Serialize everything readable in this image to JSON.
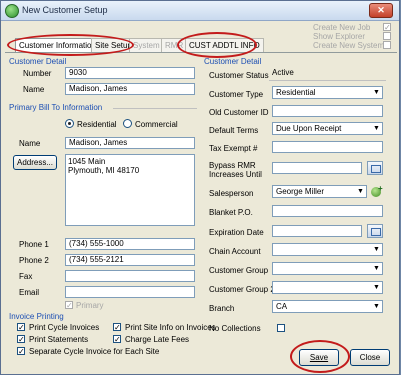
{
  "window": {
    "title": "New Customer Setup",
    "close": "✕"
  },
  "top_links": [
    {
      "label": "Create New Job",
      "checked": true
    },
    {
      "label": "Show Explorer",
      "checked": false
    },
    {
      "label": "Create New System",
      "checked": false
    }
  ],
  "tabs": [
    "Customer Information",
    "Site Setup",
    "System",
    "RMR",
    "CUST ADDTL INFO"
  ],
  "customer_detail": {
    "header": "Customer Detail",
    "number_label": "Number",
    "number": "9030",
    "name_label": "Name",
    "name": "Madison, James"
  },
  "bill_to": {
    "header": "Primary Bill To Information",
    "residential_label": "Residential",
    "commercial_label": "Commercial",
    "name_label": "Name",
    "name": "Madison, James",
    "address_button": "Address...",
    "address_line1": "1045 Main",
    "address_line2": "Plymouth, MI  48170",
    "phone1_label": "Phone 1",
    "phone1": "(734) 555-1000",
    "phone2_label": "Phone 2",
    "phone2": "(734) 555-2121",
    "fax_label": "Fax",
    "email_label": "Email",
    "primary_label": "Primary"
  },
  "invoice_printing": {
    "header": "Invoice Printing",
    "print_cycle": "Print Cycle Invoices",
    "print_site_info": "Print Site Info on Invoices",
    "print_statements": "Print Statements",
    "charge_late_fees": "Charge Late Fees",
    "separate_cycle": "Separate Cycle Invoice for Each Site"
  },
  "right_detail": {
    "header": "Customer Detail",
    "status_label": "Customer Status",
    "status": "Active",
    "type_label": "Customer Type",
    "type": "Residential",
    "old_id_label": "Old Customer ID",
    "terms_label": "Default Terms",
    "terms": "Due Upon Receipt",
    "tax_label": "Tax Exempt #",
    "bypass_label_1": "Bypass RMR",
    "bypass_label_2": "Increases Until",
    "salesperson_label": "Salesperson",
    "salesperson": "George Miller",
    "blanket_label": "Blanket P.O.",
    "expiration_label": "Expiration Date",
    "chain_label": "Chain Account",
    "group_label": "Customer Group",
    "group2_label": "Customer Group 2",
    "branch_label": "Branch",
    "branch": "CA",
    "no_collections_label": "No Collections"
  },
  "buttons": {
    "save": "Save",
    "close": "Close"
  },
  "dropdown_arrow": "▼"
}
